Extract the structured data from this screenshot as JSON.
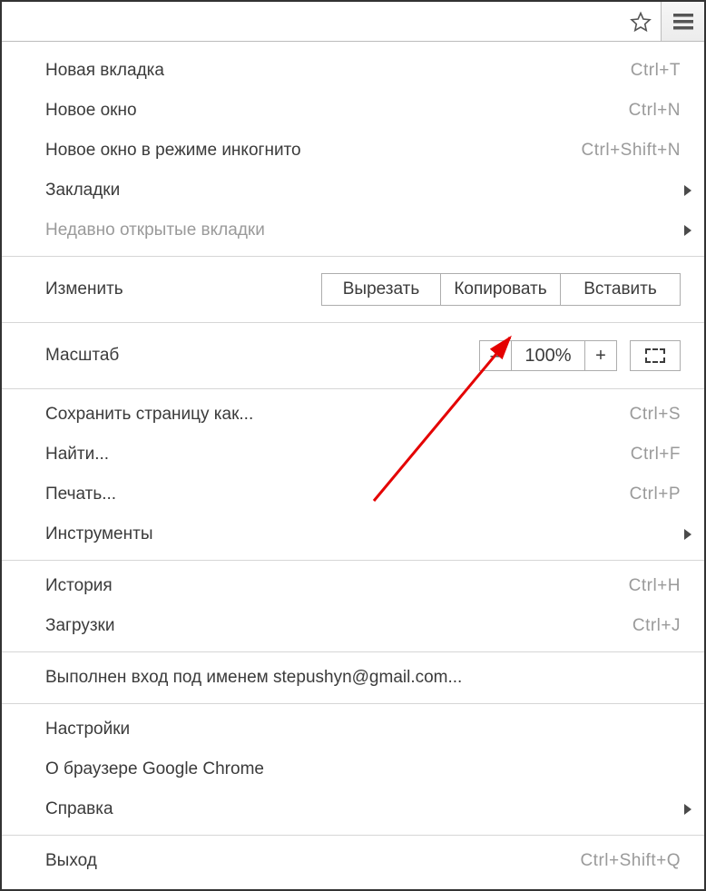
{
  "toolbar": {
    "star_icon": "star-icon",
    "menu_icon": "hamburger-icon"
  },
  "menu": {
    "new_tab": {
      "label": "Новая вкладка",
      "shortcut": "Ctrl+T"
    },
    "new_window": {
      "label": "Новое окно",
      "shortcut": "Ctrl+N"
    },
    "incognito": {
      "label": "Новое окно в режиме инкогнито",
      "shortcut": "Ctrl+Shift+N"
    },
    "bookmarks": {
      "label": "Закладки"
    },
    "recent_tabs": {
      "label": "Недавно открытые вкладки"
    },
    "edit": {
      "label": "Изменить",
      "cut": "Вырезать",
      "copy": "Копировать",
      "paste": "Вставить"
    },
    "zoom": {
      "label": "Масштаб",
      "minus": "–",
      "value": "100%",
      "plus": "+"
    },
    "save_page": {
      "label": "Сохранить страницу как...",
      "shortcut": "Ctrl+S"
    },
    "find": {
      "label": "Найти...",
      "shortcut": "Ctrl+F"
    },
    "print": {
      "label": "Печать...",
      "shortcut": "Ctrl+P"
    },
    "tools": {
      "label": "Инструменты"
    },
    "history": {
      "label": "История",
      "shortcut": "Ctrl+H"
    },
    "downloads": {
      "label": "Загрузки",
      "shortcut": "Ctrl+J"
    },
    "signed_in": {
      "label": "Выполнен вход под именем stepushyn@gmail.com..."
    },
    "settings": {
      "label": "Настройки"
    },
    "about": {
      "label": "О браузере Google Chrome"
    },
    "help": {
      "label": "Справка"
    },
    "exit": {
      "label": "Выход",
      "shortcut": "Ctrl+Shift+Q"
    }
  }
}
